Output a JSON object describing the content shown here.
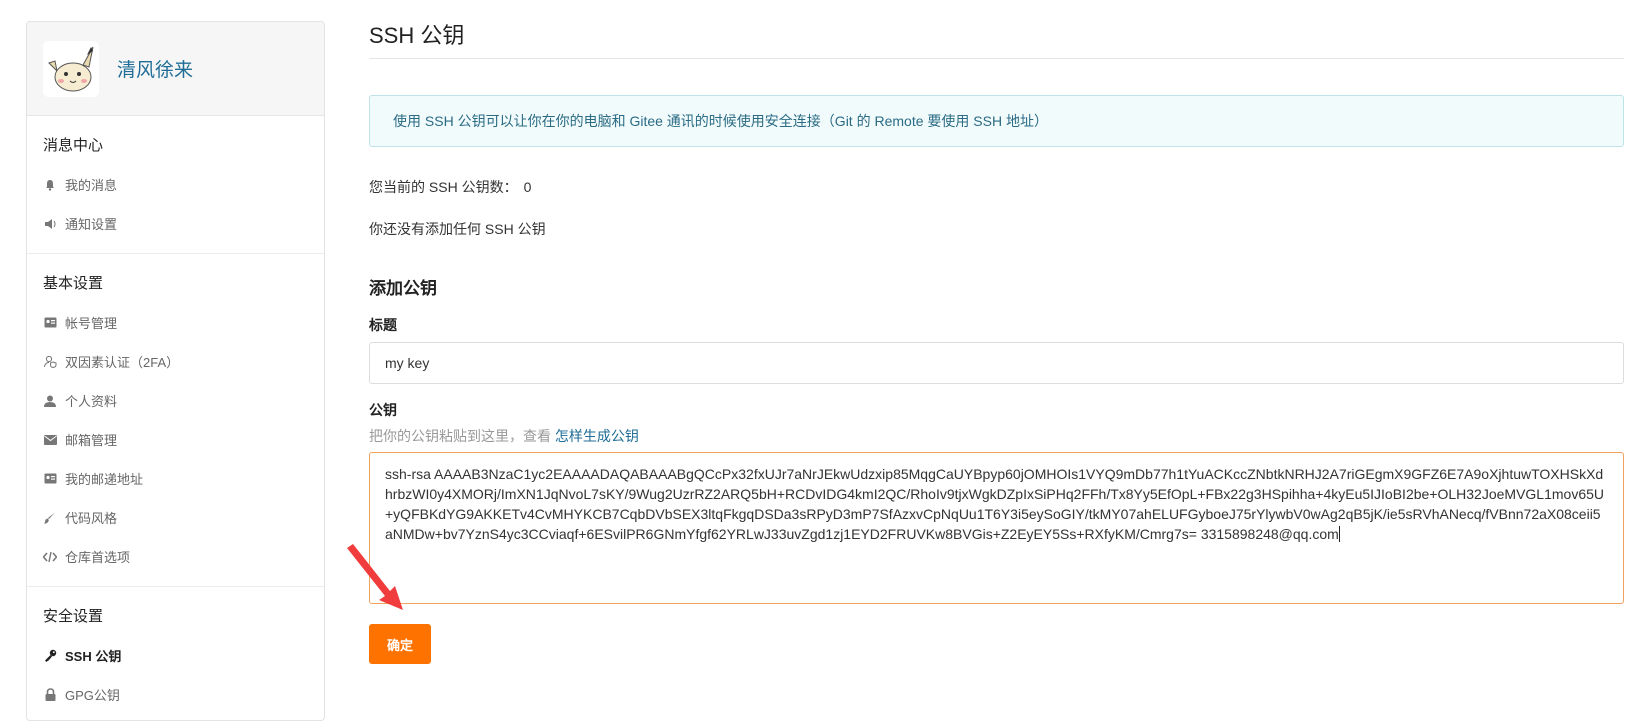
{
  "sidebar": {
    "username": "清风徐来",
    "sections": [
      {
        "title": "消息中心",
        "items": [
          {
            "label": "我的消息",
            "icon": "bell-icon"
          },
          {
            "label": "通知设置",
            "icon": "speaker-icon"
          }
        ]
      },
      {
        "title": "基本设置",
        "items": [
          {
            "label": "帐号管理",
            "icon": "id-card-icon"
          },
          {
            "label": "双因素认证（2FA）",
            "icon": "user-shield-icon"
          },
          {
            "label": "个人资料",
            "icon": "user-icon"
          },
          {
            "label": "邮箱管理",
            "icon": "envelope-icon"
          },
          {
            "label": "我的邮递地址",
            "icon": "address-card-icon"
          },
          {
            "label": "代码风格",
            "icon": "brush-icon"
          },
          {
            "label": "仓库首选项",
            "icon": "code-icon"
          }
        ]
      },
      {
        "title": "安全设置",
        "items": [
          {
            "label": "SSH 公钥",
            "icon": "key-icon",
            "active": true
          },
          {
            "label": "GPG公钥",
            "icon": "lock-icon"
          }
        ]
      }
    ]
  },
  "main": {
    "title": "SSH 公钥",
    "info": "使用 SSH 公钥可以让你在你的电脑和 Gitee 通讯的时候使用安全连接（Git 的 Remote 要使用 SSH 地址）",
    "count_label": "您当前的 SSH 公钥数：",
    "count_value": "0",
    "no_keys": "你还没有添加任何 SSH 公钥",
    "add_title": "添加公钥",
    "title_label": "标题",
    "title_value": "my key",
    "key_label": "公钥",
    "key_hint": "把你的公钥粘贴到这里，查看",
    "key_hint_link": "怎样生成公钥",
    "key_value": "ssh-rsa AAAAB3NzaC1yc2EAAAADAQABAAABgQCcPx32fxUJr7aNrJEkwUdzxip85MqgCaUYBpyp60jOMHOIs1VYQ9mDb77h1tYuACKccZNbtkNRHJ2A7riGEgmX9GFZ6E7A9oXjhtuwTOXHSkXdhrbzWI0y4XMORj/ImXN1JqNvoL7sKY/9Wug2UzrRZ2ARQ5bH+RCDvIDG4kmI2QC/RhoIv9tjxWgkDZpIxSiPHq2FFh/Tx8Yy5EfOpL+FBx22g3HSpihha+4kyEu5IJIoBI2be+OLH32JoeMVGL1mov65U+yQFBKdYG9AKKETv4CvMHYKCB7CqbDVbSEX3ltqFkgqDSDa3sRPyD3mP7SfAzxvCpNqUu1T6Y3i5eySoGIY/tkMY07ahELUFGyboeJ75rYlywbV0wAg2qB5jK/ie5sRVhANecq/fVBnn72aX08ceii5aNMDw+bv7YznS4yc3CCviaqf+6ESvilPR6GNmYfgf62YRLwJ33uvZgd1zj1EYD2FRUVKw8BVGis+Z2EyEY5Ss+RXfyKM/Cmrg7s= 3315898248@qq.com",
    "confirm_label": "确定"
  },
  "colors": {
    "accent": "#fe7300",
    "link": "#1f6d96",
    "info_bg": "#f1fbfc",
    "arrow": "#f03c3c"
  }
}
